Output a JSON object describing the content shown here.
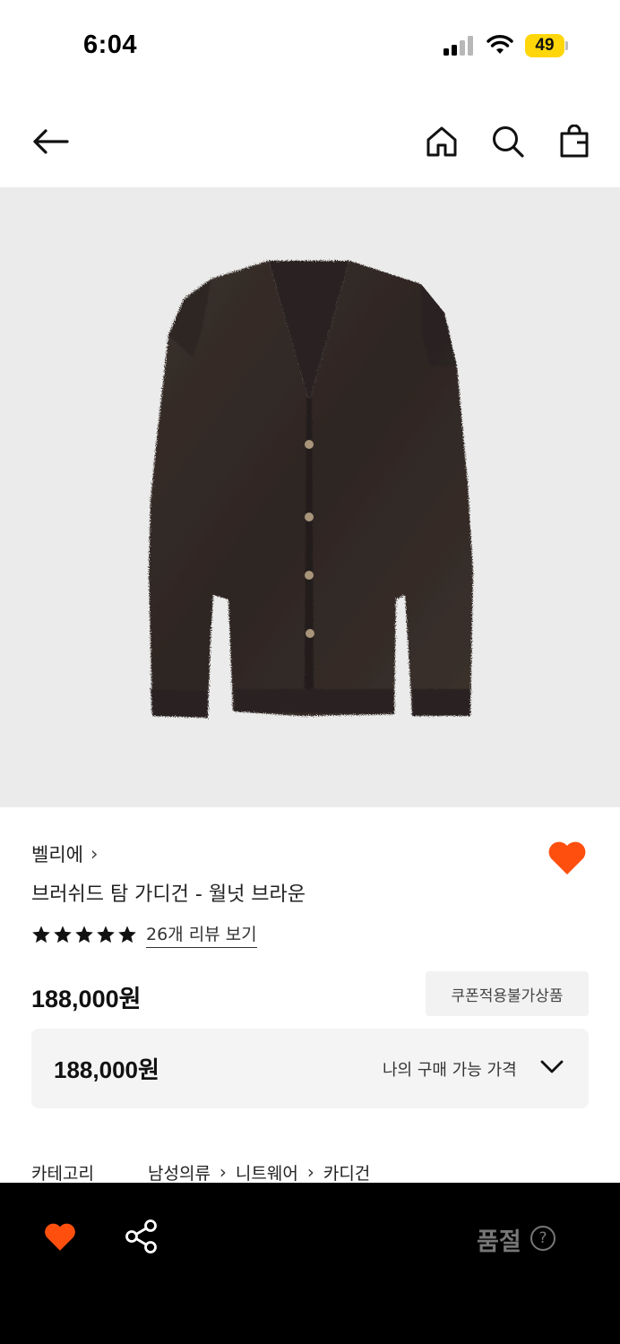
{
  "status": {
    "time": "6:04",
    "battery_level": "49",
    "battery_color": "#ffd60a"
  },
  "nav": {
    "icons": [
      "arrow-left-icon",
      "home-icon",
      "search-icon",
      "shopping-bag-icon"
    ]
  },
  "product": {
    "brand": "벨리에",
    "brand_chevron": "›",
    "name": "브러쉬드 탐 가디건 - 월넛 브라운",
    "rating_stars": 5,
    "review_link": "26개 리뷰 보기",
    "price": "188,000원",
    "coupon_badge": "쿠폰적용불가상품",
    "my_price": {
      "value": "188,000원",
      "label": "나의 구매 가능 가격"
    },
    "category": {
      "label": "카테고리",
      "path": [
        "남성의류",
        "니트웨어",
        "카디건"
      ],
      "separator": "›"
    },
    "accent_color": "#ff4f0f"
  },
  "bottom_bar": {
    "sold_out": "품절",
    "help_glyph": "?"
  }
}
